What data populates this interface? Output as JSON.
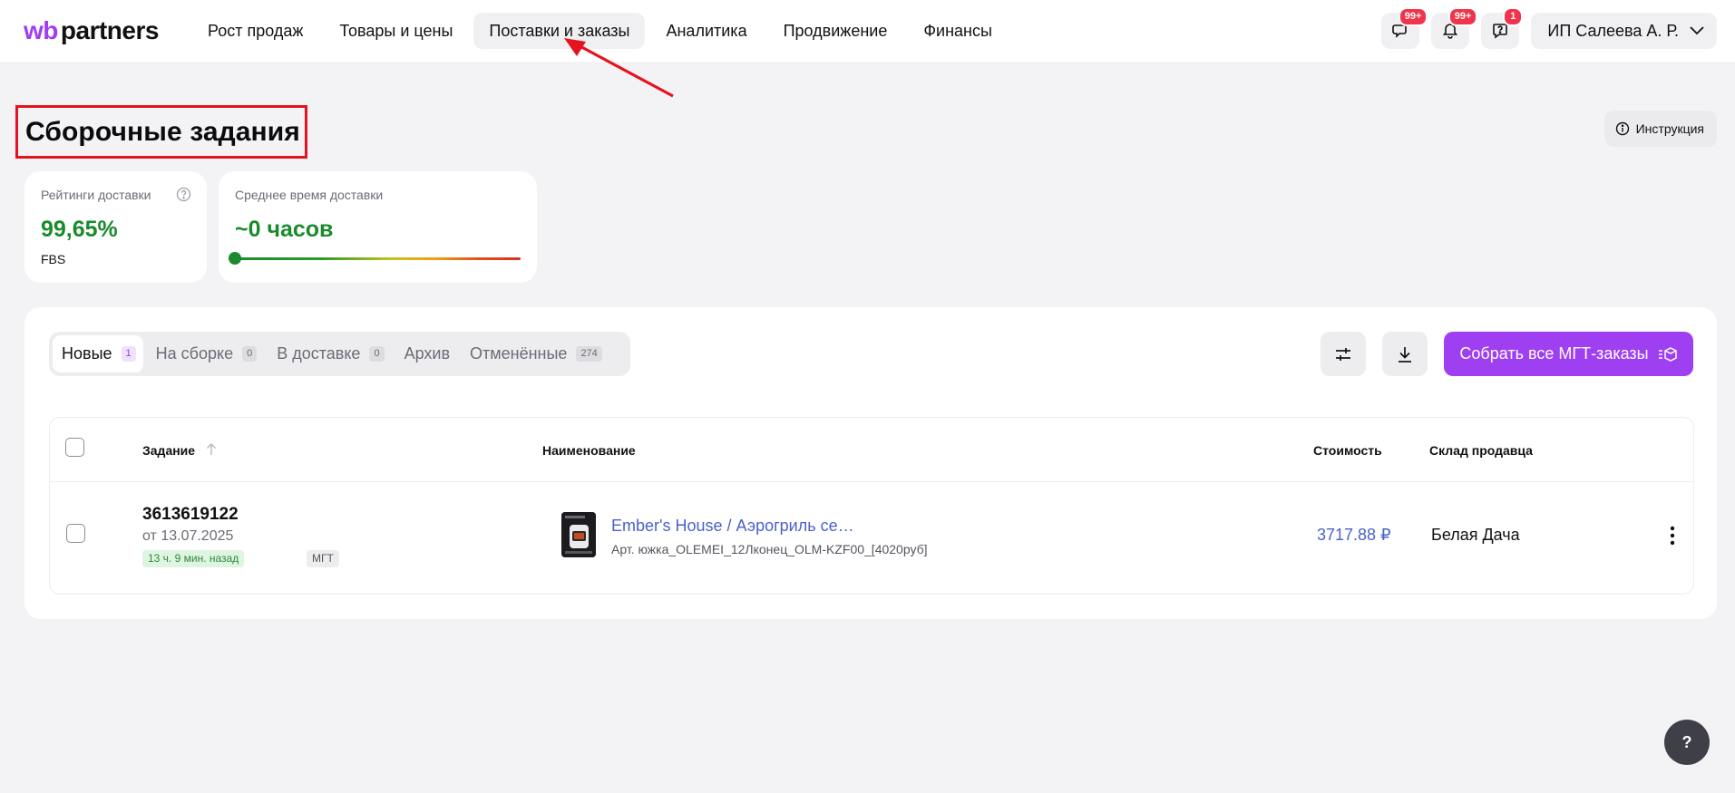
{
  "header": {
    "logo_wb": "wb",
    "logo_partners": "partners",
    "nav": [
      {
        "label": "Рост продаж"
      },
      {
        "label": "Товары и цены"
      },
      {
        "label": "Поставки и заказы",
        "active": true
      },
      {
        "label": "Аналитика"
      },
      {
        "label": "Продвижение"
      },
      {
        "label": "Финансы"
      }
    ],
    "icons": {
      "chat": {
        "icon": "chat-icon",
        "badge": "99+"
      },
      "notifications": {
        "icon": "bell-icon",
        "badge": "99+"
      },
      "support": {
        "icon": "question-chat-icon",
        "badge": "1"
      }
    },
    "user_name": "ИП Салеева А. Р."
  },
  "page": {
    "title": "Сборочные задания",
    "instruction_label": "Инструкция"
  },
  "stats": {
    "rating": {
      "label": "Рейтинги доставки",
      "value": "99,65%",
      "sub": "FBS"
    },
    "delivery_time": {
      "label": "Среднее время доставки",
      "value": "~0 часов",
      "level": 0
    }
  },
  "tabs": [
    {
      "label": "Новые",
      "count": "1",
      "active": true
    },
    {
      "label": "На сборке",
      "count": "0"
    },
    {
      "label": "В доставке",
      "count": "0"
    },
    {
      "label": "Архив",
      "count": ""
    },
    {
      "label": "Отменённые",
      "count": "274"
    }
  ],
  "actions": {
    "collect_label": "Собрать все МГТ-заказы"
  },
  "table": {
    "columns": {
      "task": "Задание",
      "name": "Наименование",
      "price": "Стоимость",
      "warehouse": "Склад продавца"
    },
    "rows": [
      {
        "order_number": "3613619122",
        "date": "от 13.07.2025",
        "time_ago": "13 ч. 9 мин. назад",
        "tag": "МГТ",
        "product_name": "Ember's House / Аэрогриль се…",
        "article": "Арт. южка_OLEMEI_12Лконец_OLM-KZF00_[4020руб]",
        "price": "3717.88 ₽",
        "warehouse": "Белая Дача"
      }
    ]
  },
  "help_fab": "?",
  "colors": {
    "brand": "#a23bf3",
    "primary_button": "#9f3ff2",
    "success": "#1b8a2d",
    "link": "#4a62c9",
    "badge": "#f0344b",
    "annotation": "#e5131f"
  }
}
